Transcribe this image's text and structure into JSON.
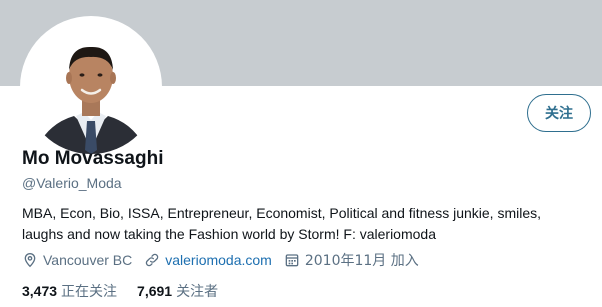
{
  "profile": {
    "name": "Mo Movassaghi",
    "handle": "@Valerio_Moda",
    "bio_line1": "MBA, Econ, Bio, ISSA, Entrepreneur, Economist, Political and fitness junkie, smiles,",
    "bio_line2": "laughs and now taking the Fashion world by Storm! F: valeriomoda",
    "location": "Vancouver BC",
    "website": "valeriomoda.com",
    "joined": "2010年11月 加入"
  },
  "actions": {
    "follow_label": "关注"
  },
  "stats": {
    "following_count": "3,473",
    "following_label": "正在关注",
    "followers_count": "7,691",
    "followers_label": "关注者"
  },
  "icons": {
    "location": "location-pin-icon",
    "link": "link-icon",
    "calendar": "calendar-icon"
  },
  "colors": {
    "banner": "#c7ccd0",
    "accent": "#2f6f8f",
    "link": "#1d6fb0",
    "secondary_text": "#5b7083"
  }
}
